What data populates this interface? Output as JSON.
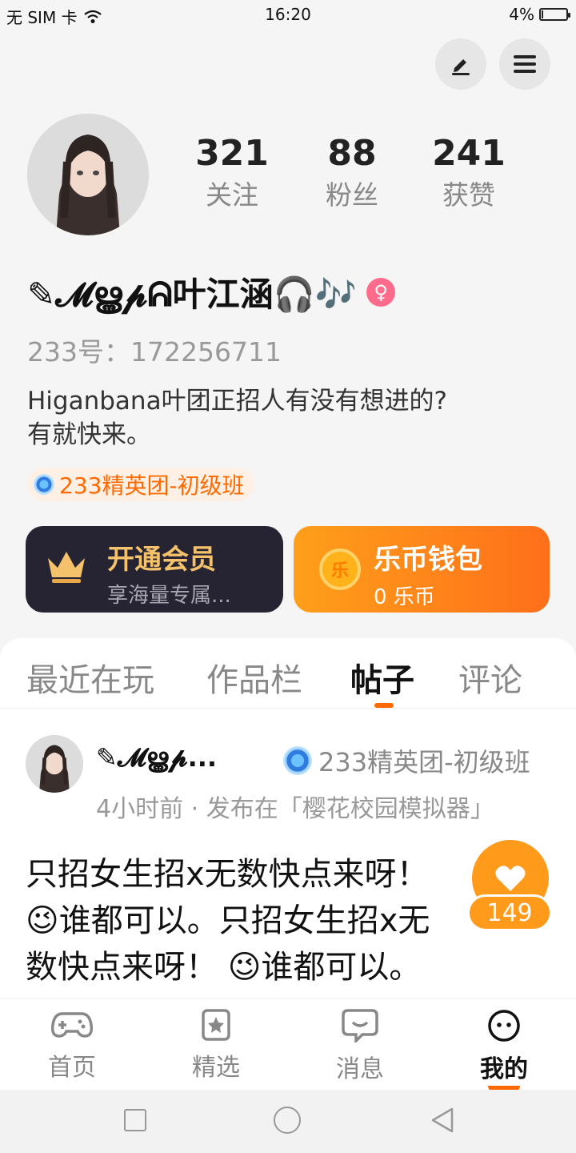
{
  "status_bar": {
    "carrier": "无 SIM 卡",
    "time": "16:20",
    "battery": "4%"
  },
  "header_actions": {
    "edit_icon": "edit-icon",
    "menu_icon": "hamburger-menu-icon"
  },
  "profile": {
    "stats": [
      {
        "value": "321",
        "label": "关注"
      },
      {
        "value": "88",
        "label": "粉丝"
      },
      {
        "value": "241",
        "label": "获赞"
      }
    ],
    "name": "✎𝓜ൠ𝓹ᕱ叶江涵🎧🎶",
    "gender_symbol": "♀",
    "id_text": "233号：172256711",
    "bio_line1": "Higanbana叶团正招人有没有想进的?",
    "bio_line2": "有就快来。",
    "badge": "233精英团-初级班"
  },
  "cards": {
    "vip": {
      "title": "开通会员",
      "subtitle": "享海量专属..."
    },
    "wallet": {
      "title": "乐币钱包",
      "subtitle": "0 乐币",
      "coin_char": "乐"
    }
  },
  "tabs": [
    "最近在玩",
    "作品栏",
    "帖子",
    "评论"
  ],
  "active_tab": "帖子",
  "post": {
    "author": "✎𝓜ൠ𝓹...",
    "badge": "233精英团-初级班",
    "meta": "4小时前 · 发布在「樱花校园模拟器」",
    "content_line1": "只招女生招x无数快点来呀！",
    "content_line2": "😉谁都可以。只招女生招x无",
    "content_line3": "数快点来呀！ 😉谁都可以。",
    "likes": "149"
  },
  "bottom_nav": [
    {
      "label": "首页",
      "icon": "gamepad-icon"
    },
    {
      "label": "精选",
      "icon": "star-icon"
    },
    {
      "label": "消息",
      "icon": "chat-icon"
    },
    {
      "label": "我的",
      "icon": "profile-face-icon"
    }
  ],
  "colors": {
    "accent": "#ff6a00",
    "gender": "#ff6b8b",
    "vip_bg": "#262433",
    "vip_gold": "#f5c26b"
  }
}
